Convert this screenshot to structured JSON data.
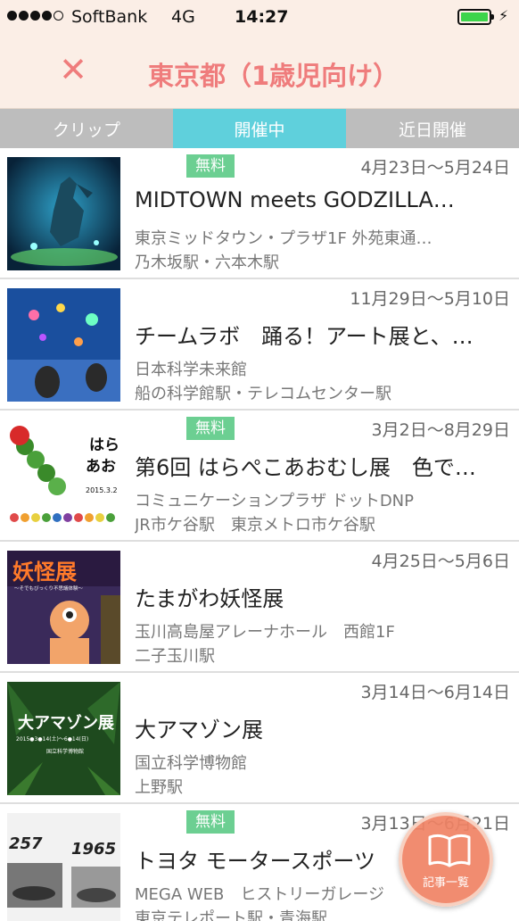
{
  "status_bar": {
    "carrier": "SoftBank",
    "network": "4G",
    "time": "14:27",
    "battery_level": 1.0,
    "battery_color": "#3dd44b"
  },
  "nav": {
    "title": "東京都（1歳児向け）",
    "close_icon": "close-icon",
    "accent_color": "#ef7c7c"
  },
  "tabs": [
    {
      "label": "クリップ",
      "active": false
    },
    {
      "label": "開催中",
      "active": true
    },
    {
      "label": "近日開催",
      "active": false
    }
  ],
  "events": [
    {
      "free": "無料",
      "date": "4月23日〜5月24日",
      "title": "MIDTOWN meets GODZILLA…",
      "venue": "東京ミッドタウン・プラザ1F 外苑東通…",
      "station": "乃木坂駅・六本木駅"
    },
    {
      "free": "",
      "date": "11月29日〜5月10日",
      "title": "チームラボ　踊る！アート展と、…",
      "venue": "日本科学未来館",
      "station": "船の科学館駅・テレコムセンター駅"
    },
    {
      "free": "無料",
      "date": "3月2日〜8月29日",
      "title": "第6回 はらぺこあおむし展　色で…",
      "venue": "コミュニケーションプラザ ドットDNP",
      "station": "JR市ケ谷駅　東京メトロ市ケ谷駅"
    },
    {
      "free": "",
      "date": "4月25日〜5月6日",
      "title": "たまがわ妖怪展",
      "venue": "玉川高島屋アレーナホール　西館1F",
      "station": "二子玉川駅"
    },
    {
      "free": "",
      "date": "3月14日〜6月14日",
      "title": "大アマゾン展",
      "venue": "国立科学博物館",
      "station": "上野駅"
    },
    {
      "free": "無料",
      "date": "3月13日〜6月21日",
      "title": "トヨタ モータースポーツ",
      "venue": "MEGA WEB　ヒストリーガレージ",
      "station": "東京テレポート駅・青海駅"
    }
  ],
  "thumb_texts": {
    "yokai": "妖怪展",
    "yokai_sub": "〜そでもびっくり不思議体験〜",
    "amazon": "大アマゾン展",
    "amazon_sub": "2015●3●14(土)〜6●14(日)",
    "amazon_museum": "国立科学博物館",
    "harapeko1": "はら",
    "harapeko2": "あお",
    "harapeko_date": "2015.3.2",
    "toyota_year1": "257",
    "toyota_year2": "1965"
  },
  "fab": {
    "label": "記事一覧",
    "icon": "book-icon"
  }
}
